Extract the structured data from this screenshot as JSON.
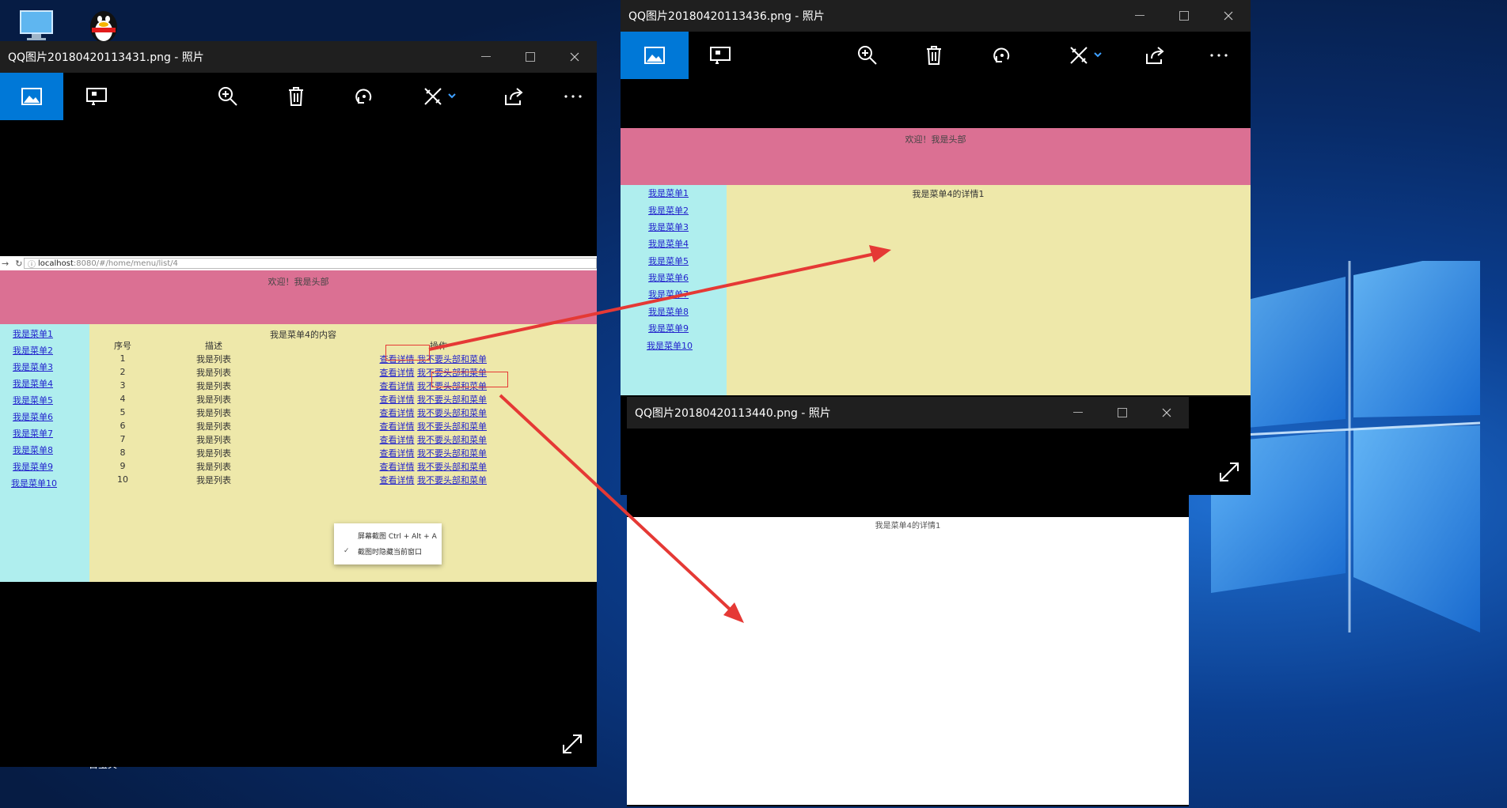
{
  "desktop": {
    "partial_icon_text": "百宝夹"
  },
  "win1": {
    "title": "QQ图片20180420113431.png - 照片",
    "url": {
      "host": "localhost",
      "path": ":8080/#/home/menu/list/4"
    },
    "header_text": "欢迎！我是头部",
    "menu": [
      "我是菜单1",
      "我是菜单2",
      "我是菜单3",
      "我是菜单4",
      "我是菜单5",
      "我是菜单6",
      "我是菜单7",
      "我是菜单8",
      "我是菜单9",
      "我是菜单10"
    ],
    "content_title": "我是菜单4的内容",
    "table": {
      "headers": [
        "序号",
        "描述",
        "操作"
      ],
      "rows": [
        {
          "num": "1",
          "desc": "我是列表",
          "detail": "查看详情",
          "nohead": "我不要头部和菜单"
        },
        {
          "num": "2",
          "desc": "我是列表",
          "detail": "查看详情",
          "nohead": "我不要头部和菜单"
        },
        {
          "num": "3",
          "desc": "我是列表",
          "detail": "查看详情",
          "nohead": "我不要头部和菜单"
        },
        {
          "num": "4",
          "desc": "我是列表",
          "detail": "查看详情",
          "nohead": "我不要头部和菜单"
        },
        {
          "num": "5",
          "desc": "我是列表",
          "detail": "查看详情",
          "nohead": "我不要头部和菜单"
        },
        {
          "num": "6",
          "desc": "我是列表",
          "detail": "查看详情",
          "nohead": "我不要头部和菜单"
        },
        {
          "num": "7",
          "desc": "我是列表",
          "detail": "查看详情",
          "nohead": "我不要头部和菜单"
        },
        {
          "num": "8",
          "desc": "我是列表",
          "detail": "查看详情",
          "nohead": "我不要头部和菜单"
        },
        {
          "num": "9",
          "desc": "我是列表",
          "detail": "查看详情",
          "nohead": "我不要头部和菜单"
        },
        {
          "num": "10",
          "desc": "我是列表",
          "detail": "查看详情",
          "nohead": "我不要头部和菜单"
        }
      ]
    },
    "context_menu": {
      "item1": "屏幕截图 Ctrl + Alt + A",
      "item2": "截图时隐藏当前窗口",
      "item2_check": "✓"
    }
  },
  "win2": {
    "title": "QQ图片20180420113436.png - 照片",
    "header_text": "欢迎！我是头部",
    "menu": [
      "我是菜单1",
      "我是菜单2",
      "我是菜单3",
      "我是菜单4",
      "我是菜单5",
      "我是菜单6",
      "我是菜单7",
      "我是菜单8",
      "我是菜单9",
      "我是菜单10"
    ],
    "detail_text": "我是菜单4的详情1"
  },
  "win3": {
    "title": "QQ图片20180420113440.png - 照片",
    "detail_text": "我是菜单4的详情1"
  },
  "window_controls": {
    "minimize": "—",
    "maximize": "☐",
    "close": "✕"
  },
  "toolbar_icons": [
    "photo-view-icon",
    "slideshow-icon",
    "zoom-in-icon",
    "delete-icon",
    "rotate-icon",
    "edit-icon",
    "share-icon",
    "more-icon"
  ],
  "colors": {
    "header_pink": "#db7093",
    "sidebar_cyan": "#afeeee",
    "main_khaki": "#eee8aa",
    "accent_blue": "#0078d7",
    "annotation_red": "#e53935"
  }
}
